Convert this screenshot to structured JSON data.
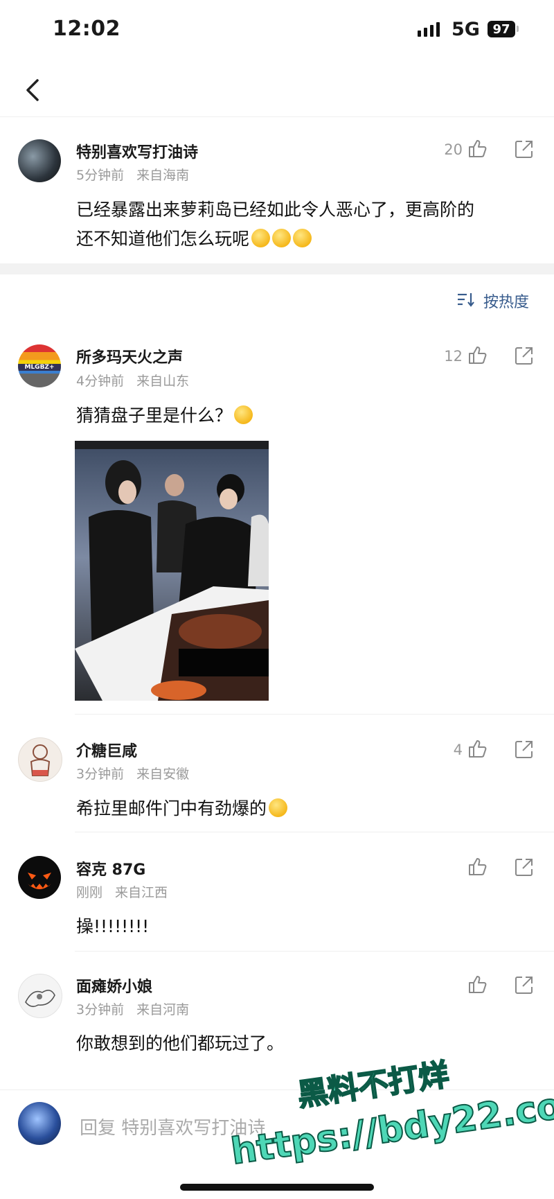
{
  "status_bar": {
    "time": "12:02",
    "network": "5G",
    "battery": "97"
  },
  "top_comment": {
    "username": "特别喜欢写打油诗",
    "time": "5分钟前",
    "location": "来自海南",
    "likes": "20",
    "text_line1": "已经暴露出来萝莉岛已经如此令人恶心了，更高阶的",
    "text_line2": "还不知道他们怎么玩呢",
    "emoji": [
      "smirk-emoji",
      "smirk-emoji",
      "smirk-emoji"
    ]
  },
  "sort": {
    "label": "按热度"
  },
  "comments": [
    {
      "username": "所多玛天火之声",
      "avatar_badge": "MLGBZ+",
      "time": "4分钟前",
      "location": "来自山东",
      "likes": "12",
      "text": "猜猜盘子里是什么？",
      "emoji": "thinking-emoji",
      "has_image": true
    },
    {
      "username": "介糖巨咸",
      "time": "3分钟前",
      "location": "来自安徽",
      "likes": "4",
      "text": "希拉里邮件门中有劲爆的",
      "emoji": "doge-emoji"
    },
    {
      "username": "容克 87G",
      "time": "刚刚",
      "location": "来自江西",
      "likes": "",
      "text": "操!!!!!!!!"
    },
    {
      "username": "面瘫娇小娘",
      "time": "3分钟前",
      "location": "来自河南",
      "likes": "",
      "text": "你敢想到的他们都玩过了。"
    }
  ],
  "reply_bar": {
    "placeholder": "回复 特别喜欢写打油诗"
  },
  "watermark": {
    "line1": "黑料不打烊",
    "line2": "https://bdy22.co"
  },
  "colors": {
    "link_blue": "#375b8c",
    "meta_gray": "#9a9a9a",
    "watermark_green": "#4ed7b6"
  }
}
